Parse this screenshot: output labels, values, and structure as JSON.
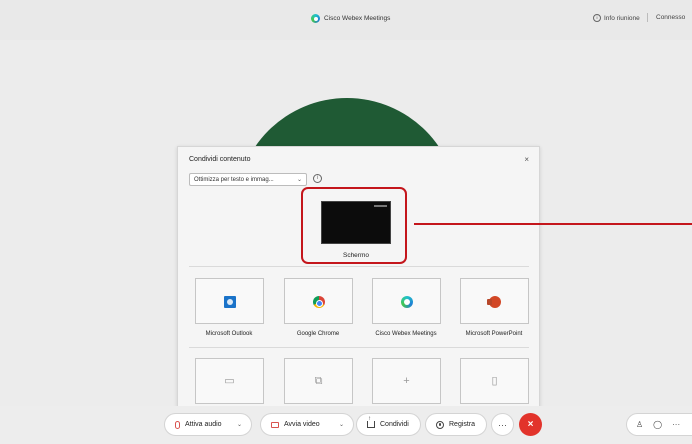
{
  "window": {
    "title": "Cisco Webex Meetings",
    "info_label": "Info riunione",
    "status": "Connesso"
  },
  "share_dialog": {
    "title": "Condividi contenuto",
    "close_glyph": "×",
    "optimize_value": "Ottimizza per testo e immag...",
    "screen_label": "Schermo",
    "apps": [
      {
        "label": "Microsoft Outlook",
        "icon": "outlook-icon"
      },
      {
        "label": "Google Chrome",
        "icon": "chrome-icon"
      },
      {
        "label": "Cisco Webex Meetings",
        "icon": "webex-icon"
      },
      {
        "label": "Microsoft PowerPoint",
        "icon": "powerpoint-icon"
      }
    ],
    "other_icons": [
      "folder-icon",
      "copy-icon",
      "plus-icon",
      "tablet-icon"
    ]
  },
  "controls": {
    "audio_label": "Attiva audio",
    "video_label": "Avvia video",
    "share_label": "Condividi",
    "record_label": "Registra",
    "more_glyph": "···",
    "end_glyph": "×",
    "side_more_glyph": "···"
  },
  "colors": {
    "accent_red": "#c4161c",
    "avatar_green": "#1f5a34",
    "end_call_red": "#e2332b"
  }
}
